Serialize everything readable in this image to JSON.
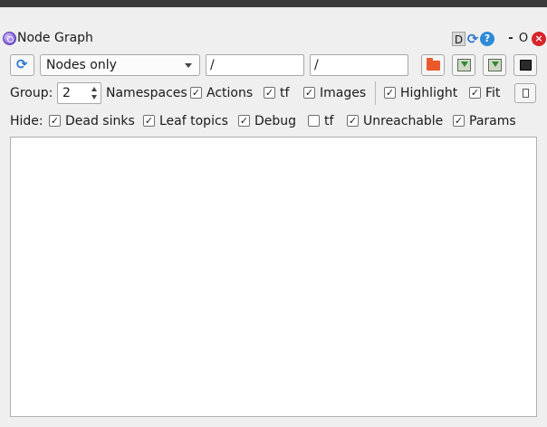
{
  "window": {
    "title": "Node Graph",
    "controls": {
      "d_label": "D",
      "reload_glyph": "⟳",
      "help_glyph": "?",
      "minimize_glyph": "-",
      "float_glyph": "O",
      "close_glyph": "×"
    }
  },
  "toolbar": {
    "refresh_glyph": "⟳",
    "graph_type": "Nodes only",
    "node_filter": "/",
    "topic_filter": "/",
    "icons": [
      "refresh-icon",
      "folder-icon",
      "save-dot-icon",
      "save-image-icon",
      "screenshot-icon"
    ]
  },
  "options": {
    "group_label": "Group:",
    "group_value": "2",
    "namespaces_label": "Namespaces",
    "items": [
      {
        "label": "Actions",
        "checked": true
      },
      {
        "label": "tf",
        "checked": true
      },
      {
        "label": "Images",
        "checked": true
      },
      {
        "label": "Highlight",
        "checked": true
      },
      {
        "label": "Fit",
        "checked": true
      }
    ]
  },
  "hide": {
    "label": "Hide:",
    "items": [
      {
        "label": "Dead sinks",
        "checked": true
      },
      {
        "label": "Leaf topics",
        "checked": true
      },
      {
        "label": "Debug",
        "checked": true
      },
      {
        "label": "tf",
        "checked": false
      },
      {
        "label": "Unreachable",
        "checked": true
      },
      {
        "label": "Params",
        "checked": true
      }
    ]
  },
  "check_glyph": "✓",
  "colors": {
    "accent": "#2e8ad8",
    "close": "#d9242a",
    "folder": "#e8592b"
  }
}
